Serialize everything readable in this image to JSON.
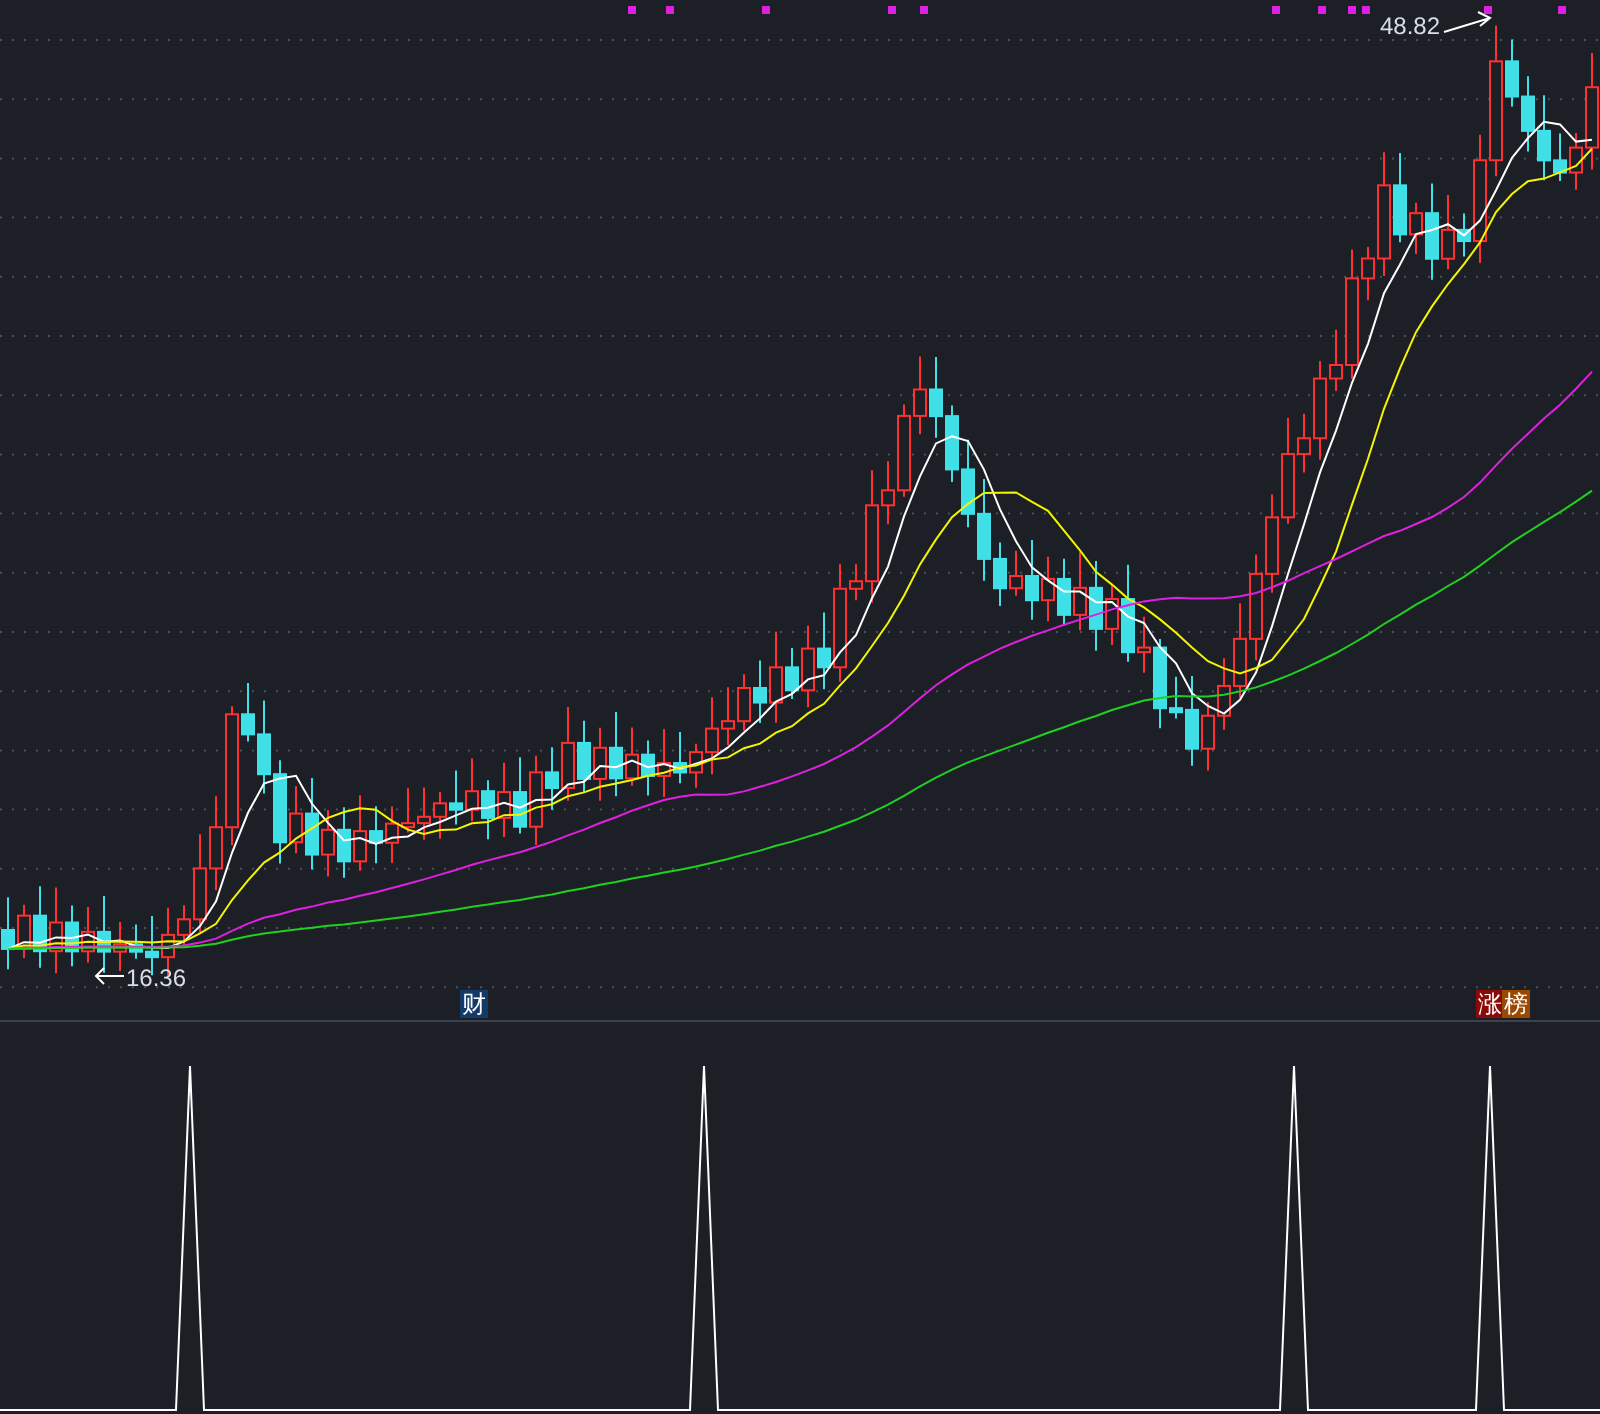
{
  "price_pane": {
    "high_label": "48.82",
    "low_label": "16.36",
    "markers": [
      {
        "text": "财",
        "kind": "finance"
      },
      {
        "text": "涨",
        "kind": "rise"
      },
      {
        "text": "榜",
        "kind": "rank"
      }
    ]
  }
}
